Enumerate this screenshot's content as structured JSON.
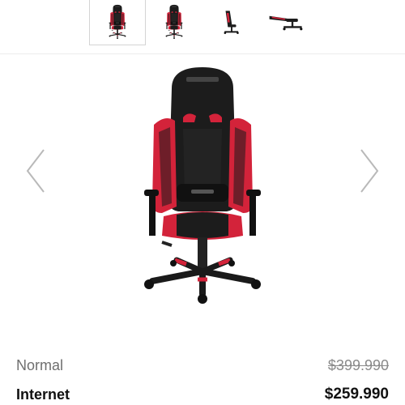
{
  "gallery": {
    "thumbnails": [
      {
        "name": "front view",
        "active": true
      },
      {
        "name": "angled view",
        "active": false
      },
      {
        "name": "side view",
        "active": false
      },
      {
        "name": "reclined view",
        "active": false
      }
    ],
    "prev_icon": "chevron-left-icon",
    "next_icon": "chevron-right-icon",
    "colors": {
      "accent": "#d3233a",
      "body": "#1a1a1a"
    }
  },
  "pricing": {
    "normal_label": "Normal",
    "normal_price": "$399.990",
    "internet_label": "Internet",
    "internet_price": "$259.990"
  }
}
